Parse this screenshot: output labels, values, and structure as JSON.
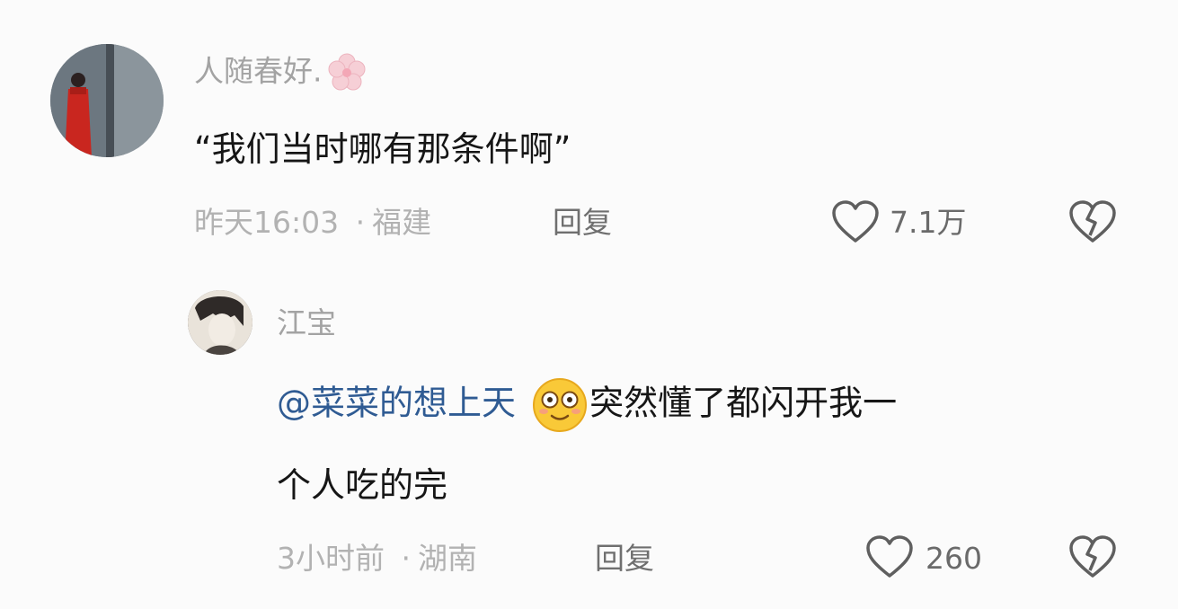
{
  "comments": [
    {
      "username": "人随春好.",
      "username_icon": "cherry-blossom-icon",
      "text": "“我们当时哪有那条件啊”",
      "time": "昨天16:03",
      "separator": "·",
      "location": "福建",
      "reply_label": "回复",
      "like_count": "7.1万"
    },
    {
      "username": "江宝",
      "mention": "@菜菜的想上天",
      "emoji": "blushing-smile-emoji",
      "text_line1": "突然懂了都闪开我一",
      "text_line2": "个人吃的完",
      "time": "3小时前",
      "separator": "·",
      "location": "湖南",
      "reply_label": "回复",
      "like_count": "260"
    }
  ],
  "colors": {
    "username": "#a3a3a3",
    "content": "#161616",
    "meta": "#b2b2b2",
    "mention": "#2f5b93",
    "icon": "#5f5f5f"
  },
  "icons": {
    "like": "heart-outline-icon",
    "dislike": "broken-heart-icon"
  }
}
